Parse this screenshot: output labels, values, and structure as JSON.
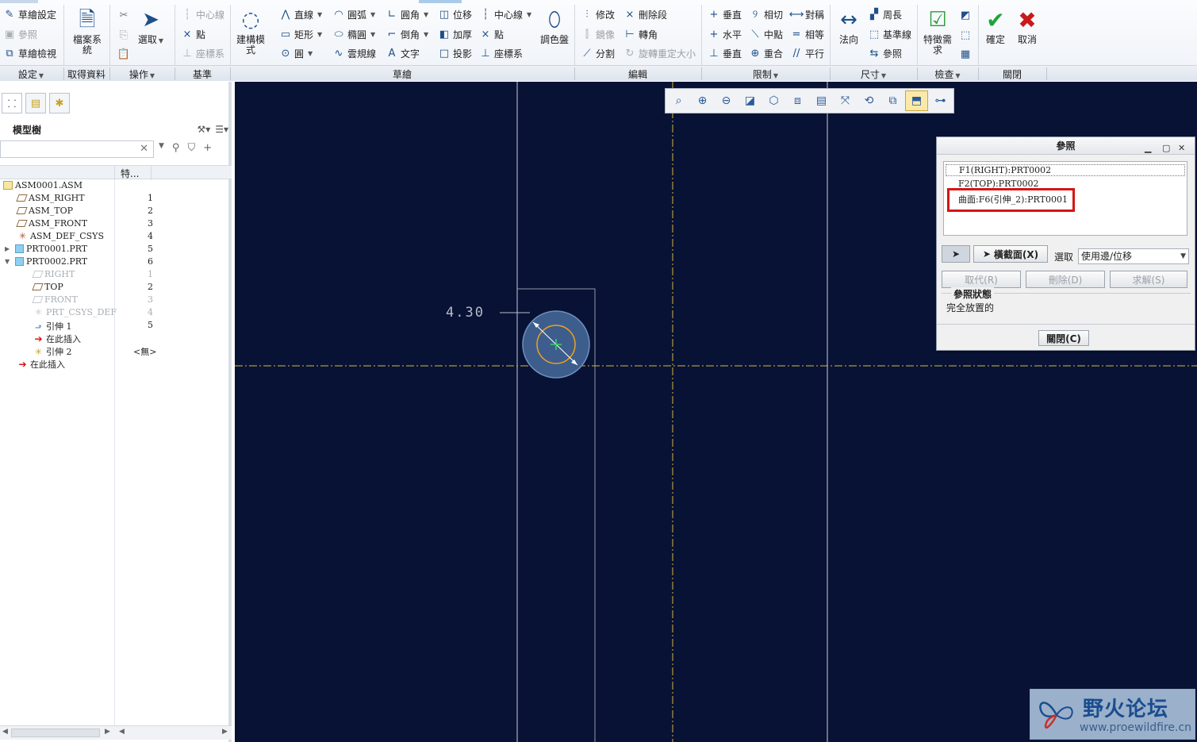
{
  "ribbon": {
    "setup": {
      "sketch_setup": "草繪設定",
      "references": "參照",
      "sketch_view": "草繪檢視"
    },
    "get_data": {
      "file_system": "檔案系統"
    },
    "operations": {
      "select": "選取"
    },
    "datum": {
      "centerline": "中心線",
      "point": "點",
      "csys": "座標系"
    },
    "construction_mode": "建構模式",
    "sketch": {
      "line": "直線",
      "arc": "圓弧",
      "fillet": "圓角",
      "offset": "位移",
      "centerline": "中心線",
      "rectangle": "矩形",
      "ellipse": "橢圓",
      "chamfer": "倒角",
      "thicken": "加厚",
      "point": "點",
      "circle": "圓",
      "spline": "雲規線",
      "text": "文字",
      "project": "投影",
      "csys": "座標系",
      "palette": "調色盤"
    },
    "editing": {
      "modify": "修改",
      "delete_segment": "刪除段",
      "mirror": "鏡像",
      "corner": "轉角",
      "divide": "分割",
      "rotate_resize": "旋轉重定大小"
    },
    "constrain": {
      "vertical": "垂直",
      "tangent": "相切",
      "symmetric": "對稱",
      "horizontal": "水平",
      "midpoint": "中點",
      "equal": "相等",
      "perpendicular": "垂直",
      "coincident": "重合",
      "parallel": "平行"
    },
    "dimension": {
      "normal": "法向",
      "perimeter": "周長",
      "baseline": "基準線",
      "reference": "參照"
    },
    "inspect": {
      "feature_requirements": "特徵需求"
    },
    "close": {
      "ok": "確定",
      "cancel": "取消"
    },
    "groups": {
      "setup": "設定",
      "get_data": "取得資料",
      "operations": "操作",
      "datum": "基準",
      "sketch": "草繪",
      "editing": "編輯",
      "constrain": "限制",
      "dimension": "尺寸",
      "inspect": "檢查",
      "close": "關閉"
    }
  },
  "model_tree": {
    "title": "模型樹",
    "column_feature": "特...",
    "search_placeholder": "",
    "items": [
      {
        "name": "ASM0001.ASM",
        "num": ""
      },
      {
        "name": "ASM_RIGHT",
        "num": "1"
      },
      {
        "name": "ASM_TOP",
        "num": "2"
      },
      {
        "name": "ASM_FRONT",
        "num": "3"
      },
      {
        "name": "ASM_DEF_CSYS",
        "num": "4"
      },
      {
        "name": "PRT0001.PRT",
        "num": "5"
      },
      {
        "name": "PRT0002.PRT",
        "num": "6"
      },
      {
        "name": "RIGHT",
        "num": "1"
      },
      {
        "name": "TOP",
        "num": "2"
      },
      {
        "name": "FRONT",
        "num": "3"
      },
      {
        "name": "PRT_CSYS_DEF",
        "num": "4"
      },
      {
        "name": "引伸 1",
        "num": "5"
      },
      {
        "name": "在此插入",
        "num": ""
      },
      {
        "name": "引伸 2",
        "num": "<無>"
      },
      {
        "name": "在此插入",
        "num": ""
      }
    ]
  },
  "canvas": {
    "dimension_value": "4.30"
  },
  "references_dialog": {
    "title": "參照",
    "items": [
      "F1(RIGHT):PRT0002",
      "F2(TOP):PRT0002",
      "曲面:F6(引伸_2):PRT0001"
    ],
    "xsec_button": "橫截面(X)",
    "select_label": "選取",
    "select_value": "使用邊/位移",
    "replace_button": "取代(R)",
    "delete_button": "刪除(D)",
    "solve_button": "求解(S)",
    "status_label": "參照狀態",
    "status_value": "完全放置的",
    "close_button": "關閉(C)"
  },
  "watermark": {
    "name": "野火论坛",
    "url": "www.proewildfire.cn"
  },
  "colors": {
    "canvas_bg": "#081234",
    "highlight": "#d41515",
    "accent": "#1f4f8a"
  }
}
